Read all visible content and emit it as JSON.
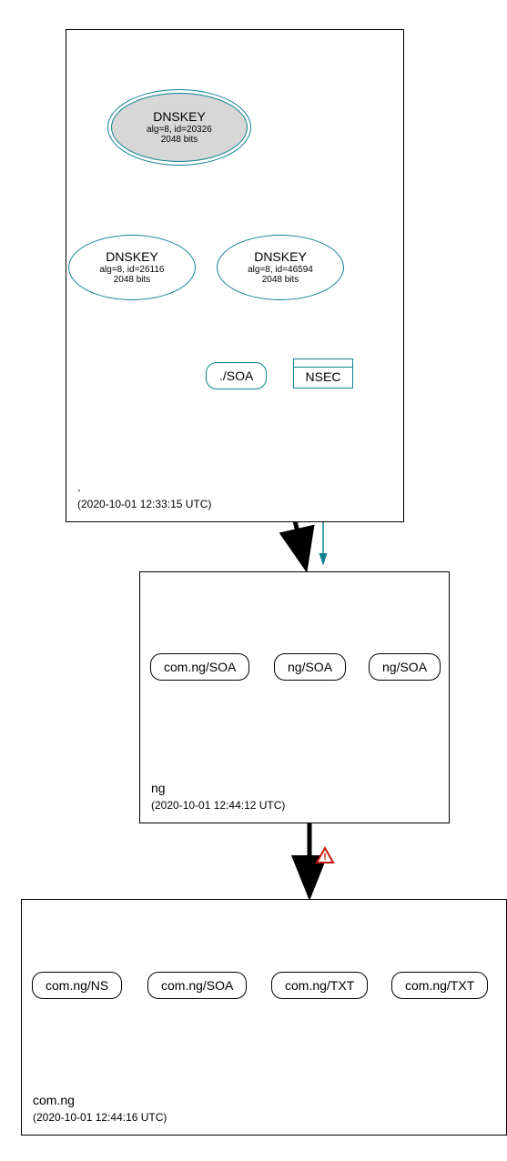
{
  "zones": {
    "root": {
      "label": ".",
      "timestamp": "(2020-10-01 12:33:15 UTC)"
    },
    "ng": {
      "label": "ng",
      "timestamp": "(2020-10-01 12:44:12 UTC)"
    },
    "comng": {
      "label": "com.ng",
      "timestamp": "(2020-10-01 12:44:16 UTC)"
    }
  },
  "dnskeys": {
    "k1": {
      "title": "DNSKEY",
      "params": "alg=8, id=20326",
      "bits": "2048 bits"
    },
    "k2": {
      "title": "DNSKEY",
      "params": "alg=8, id=26116",
      "bits": "2048 bits"
    },
    "k3": {
      "title": "DNSKEY",
      "params": "alg=8, id=46594",
      "bits": "2048 bits"
    }
  },
  "rrs": {
    "rootsoa": "./SOA",
    "nsec": "NSEC",
    "ng_comng_soa": "com.ng/SOA",
    "ng_soa1": "ng/SOA",
    "ng_soa2": "ng/SOA",
    "comng_ns": "com.ng/NS",
    "comng_soa": "com.ng/SOA",
    "comng_txt1": "com.ng/TXT",
    "comng_txt2": "com.ng/TXT"
  }
}
